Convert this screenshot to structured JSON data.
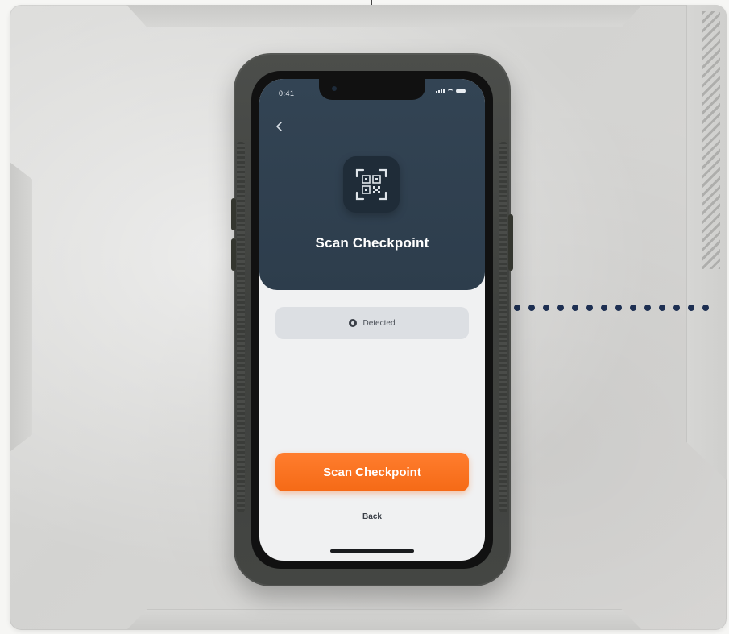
{
  "device": {
    "status_time": "0:41"
  },
  "screen": {
    "back_icon": "chevron-left-icon",
    "hero_icon": "qr-scan-icon",
    "title": "Scan Checkpoint",
    "status_chip": {
      "icon": "status-dot-icon",
      "text": "Detected"
    },
    "primary_button_label": "Scan Checkpoint",
    "secondary_link_label": "Back"
  },
  "colors": {
    "hero_bg": "#334454",
    "accent": "#f56a16",
    "chip_bg": "#dcdfe3",
    "connector_dots": "#1d2f52"
  }
}
